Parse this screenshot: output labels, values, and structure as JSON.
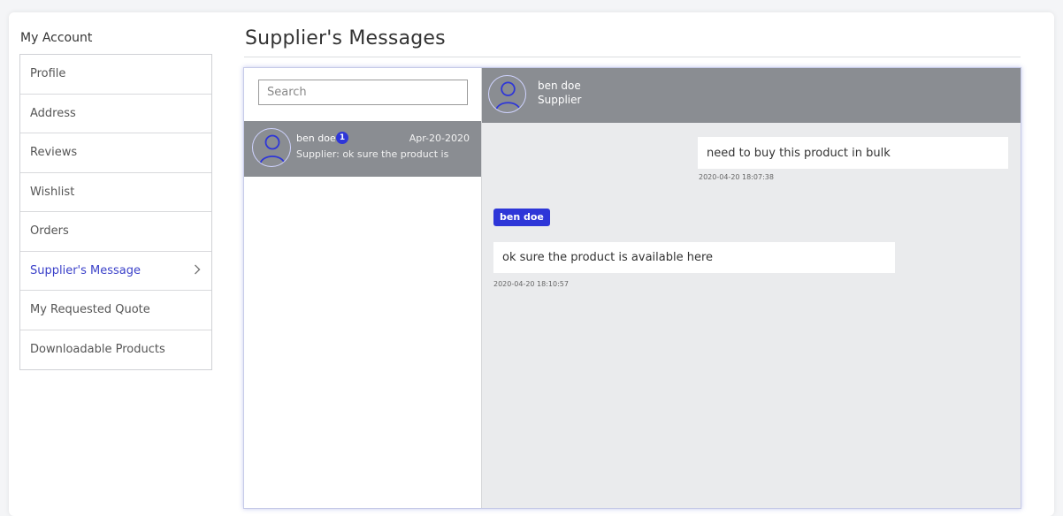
{
  "sidebar": {
    "title": "My Account",
    "items": [
      {
        "label": "Profile"
      },
      {
        "label": "Address"
      },
      {
        "label": "Reviews"
      },
      {
        "label": "Wishlist"
      },
      {
        "label": "Orders"
      },
      {
        "label": "Supplier's Message",
        "active": true
      },
      {
        "label": "My Requested Quote"
      },
      {
        "label": "Downloadable Products"
      }
    ]
  },
  "main": {
    "title": "Supplier's Messages"
  },
  "search": {
    "placeholder": "Search"
  },
  "conversation": {
    "name": "ben doe",
    "unread": "1",
    "date": "Apr-20-2020",
    "preview": "Supplier: ok sure the product is",
    "avatar_icon": "user-icon"
  },
  "chat": {
    "header": {
      "name": "ben doe",
      "role": "Supplier",
      "avatar_icon": "user-icon"
    },
    "messages": [
      {
        "direction": "out",
        "text": "need to buy this product in bulk",
        "time": "2020-04-20 18:07:38"
      },
      {
        "direction": "in",
        "sender": "ben doe",
        "text": "ok sure the product is available here",
        "time": "2020-04-20 18:10:57"
      }
    ]
  },
  "colors": {
    "accent": "#2e36d8",
    "active_link": "#3b41c9",
    "header_gray": "#8a8d92"
  }
}
